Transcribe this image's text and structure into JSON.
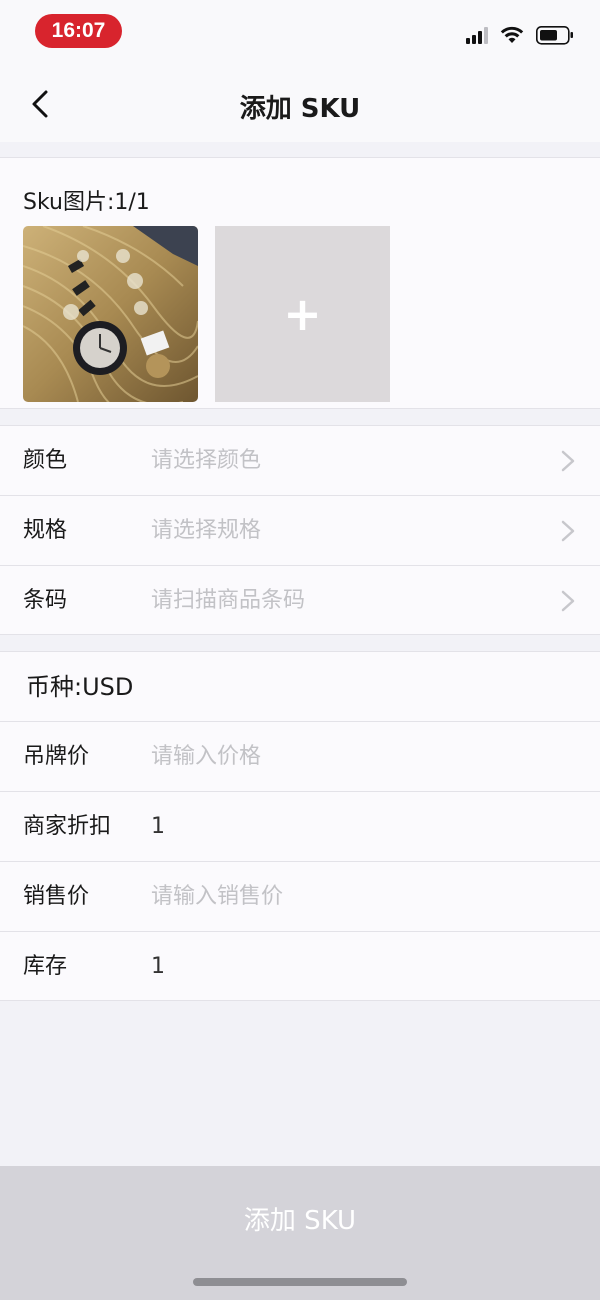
{
  "status_bar": {
    "time": "16:07"
  },
  "nav": {
    "title": "添加 SKU"
  },
  "images": {
    "label": "Sku图片:1/1",
    "add_icon": "+"
  },
  "attributes": [
    {
      "label": "颜色",
      "placeholder": "请选择颜色"
    },
    {
      "label": "规格",
      "placeholder": "请选择规格"
    },
    {
      "label": "条码",
      "placeholder": "请扫描商品条码"
    }
  ],
  "price": {
    "currency": "币种:USD",
    "tag_price": {
      "label": "吊牌价",
      "placeholder": "请输入价格"
    },
    "discount": {
      "label": "商家折扣",
      "value": "1"
    },
    "sale_price": {
      "label": "销售价",
      "placeholder": "请输入销售价"
    },
    "stock": {
      "label": "库存",
      "value": "1"
    }
  },
  "submit": {
    "label": "添加 SKU"
  },
  "icons": [
    "chevron-left-icon",
    "chevron-right-icon",
    "plus-icon",
    "signal-icon",
    "wifi-icon",
    "battery-icon"
  ],
  "colors": {
    "accent_time_pill": "#d8242d",
    "placeholder": "#c2c2c6",
    "button_disabled": "#d4d3d9"
  }
}
